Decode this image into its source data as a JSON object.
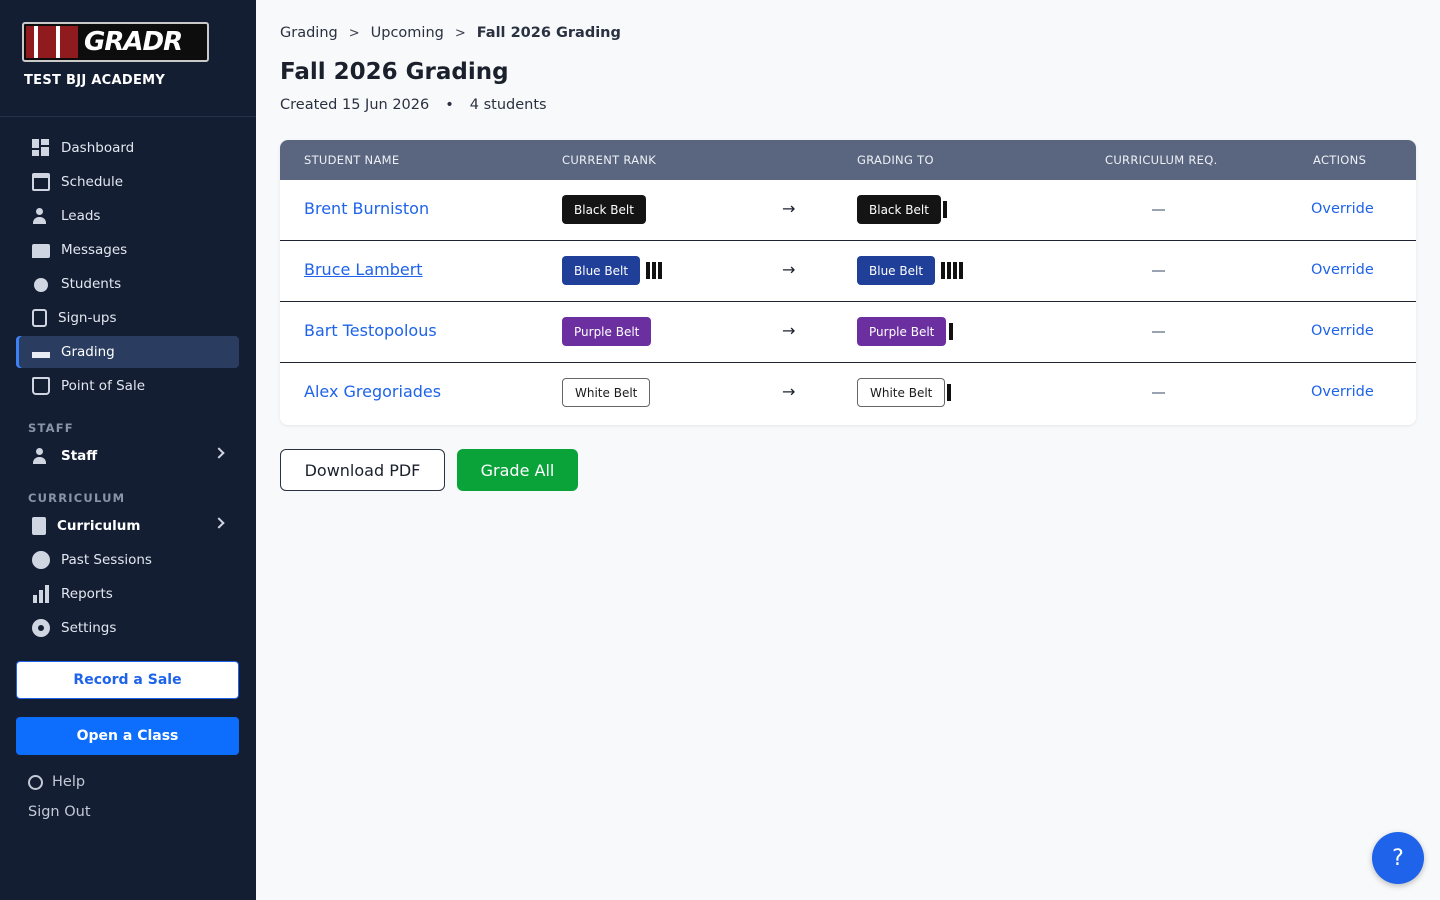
{
  "sidebar": {
    "logo_text": "GRADR",
    "academy_name": "TEST BJJ ACADEMY",
    "nav": [
      {
        "label": "Dashboard",
        "icon": "dashboard-icon"
      },
      {
        "label": "Schedule",
        "icon": "calendar-icon"
      },
      {
        "label": "Leads",
        "icon": "add-person-icon"
      },
      {
        "label": "Messages",
        "icon": "chat-icon"
      },
      {
        "label": "Students",
        "icon": "students-icon"
      },
      {
        "label": "Sign-ups",
        "icon": "clipboard-icon"
      },
      {
        "label": "Grading",
        "icon": "grading-icon",
        "active": true
      },
      {
        "label": "Point of Sale",
        "icon": "bag-icon"
      }
    ],
    "staff_section": "STAFF",
    "staff_item": "Staff",
    "curriculum_section": "CURRICULUM",
    "curriculum_item": "Curriculum",
    "more_nav": [
      {
        "label": "Past Sessions",
        "icon": "stopwatch-icon"
      },
      {
        "label": "Reports",
        "icon": "bar-chart-icon"
      },
      {
        "label": "Settings",
        "icon": "gear-icon"
      }
    ],
    "record_sale": "Record a Sale",
    "open_class": "Open a Class",
    "help": "Help",
    "sign_out": "Sign Out"
  },
  "breadcrumb": [
    "Grading",
    "Upcoming",
    "Fall 2026 Grading"
  ],
  "page": {
    "title": "Fall 2026 Grading",
    "created": "Created 15 Jun 2026",
    "separator": "•",
    "students": "4 students"
  },
  "table": {
    "headers": [
      "STUDENT NAME",
      "CURRENT RANK",
      "GRADING TO",
      "CURRICULUM REQ.",
      "ACTIONS"
    ],
    "rows": [
      {
        "name": "Brent Burniston",
        "current_belt": "Black Belt",
        "current_stripes": 0,
        "to_belt": "Black Belt",
        "to_stripes": 1,
        "curriculum": "—",
        "action": "Override"
      },
      {
        "name": "Bruce Lambert",
        "current_belt": "Blue Belt",
        "current_stripes": 3,
        "to_belt": "Blue Belt",
        "to_stripes": 4,
        "curriculum": "—",
        "action": "Override"
      },
      {
        "name": "Bart Testopolous",
        "current_belt": "Purple Belt",
        "current_stripes": 0,
        "to_belt": "Purple Belt",
        "to_stripes": 1,
        "curriculum": "—",
        "action": "Override"
      },
      {
        "name": "Alex Gregoriades",
        "current_belt": "White Belt",
        "current_stripes": 0,
        "to_belt": "White Belt",
        "to_stripes": 1,
        "curriculum": "—",
        "action": "Override"
      }
    ],
    "arrow": "→"
  },
  "actions": {
    "download_pdf": "Download PDF",
    "grade_all": "Grade All"
  },
  "fab": "?",
  "colors": {
    "sidebar_bg": "#141e33",
    "accent": "#1e63e9",
    "grade_green": "#0aa33a",
    "black_belt": "#141414",
    "blue_belt": "#1f3f99",
    "purple_belt": "#6b2fa0",
    "white_belt": "#ffffff"
  }
}
